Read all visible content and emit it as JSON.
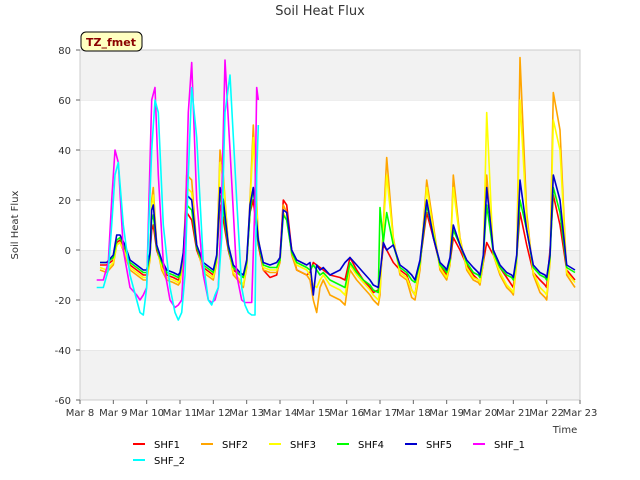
{
  "chart_data": {
    "type": "line",
    "title": "Soil Heat Flux",
    "xlabel": "Time",
    "ylabel": "Soil Heat Flux",
    "badge": "TZ_fmet",
    "ylim": [
      -60,
      80
    ],
    "yticks": [
      -60,
      -40,
      -20,
      0,
      20,
      40,
      60,
      80
    ],
    "xlim": [
      0,
      15
    ],
    "xticks": [
      0,
      1,
      2,
      3,
      4,
      5,
      6,
      7,
      8,
      9,
      10,
      11,
      12,
      13,
      14,
      15
    ],
    "xtick_labels": [
      "Mar 8",
      "Mar 9",
      "Mar 10",
      "Mar 11",
      "Mar 12",
      "Mar 13",
      "Mar 14",
      "Mar 15",
      "Mar 16",
      "Mar 17",
      "Mar 18",
      "Mar 19",
      "Mar 20",
      "Mar 21",
      "Mar 22",
      "Mar 23"
    ],
    "x_unit": "days since Mar 8",
    "grid": "horizontal bands",
    "legend_position": "bottom",
    "series": [
      {
        "name": "SHF1",
        "color": "#ff0000",
        "x": [
          0.6,
          0.8,
          1.0,
          1.1,
          1.2,
          1.35,
          1.5,
          1.7,
          1.9,
          2.0,
          2.1,
          2.15,
          2.2,
          2.3,
          2.45,
          2.6,
          2.8,
          2.95,
          3.0,
          3.1,
          3.2,
          3.35,
          3.5,
          3.7,
          3.9,
          4.0,
          4.1,
          4.2,
          4.3,
          4.45,
          4.6,
          4.8,
          4.9,
          5.0,
          5.1,
          5.2,
          5.35,
          5.5,
          5.7,
          5.9,
          6.0,
          6.1,
          6.2,
          6.35,
          6.5,
          6.8,
          6.9,
          7.0,
          7.1,
          7.2,
          7.3,
          7.5,
          7.8,
          7.95,
          8.1,
          8.3,
          8.5,
          8.7,
          8.8,
          8.95,
          9.0,
          9.1,
          9.2,
          9.4,
          9.6,
          9.8,
          9.95,
          10.05,
          10.2,
          10.4,
          10.6,
          10.8,
          10.95,
          11.0,
          11.1,
          11.2,
          11.4,
          11.6,
          11.8,
          11.95,
          12.0,
          12.1,
          12.2,
          12.4,
          12.6,
          12.8,
          12.95,
          13.0,
          13.1,
          13.2,
          13.4,
          13.6,
          13.8,
          13.95,
          14.0,
          14.1,
          14.2,
          14.4,
          14.6,
          14.85
        ],
        "y": [
          -6,
          -6,
          -4,
          3,
          4,
          0,
          -6,
          -8,
          -10,
          -10,
          -2,
          8,
          10,
          0,
          -6,
          -10,
          -11,
          -12,
          -11,
          -2,
          15,
          12,
          0,
          -7,
          -9,
          -10,
          -3,
          18,
          12,
          0,
          -8,
          -10,
          -11,
          -5,
          15,
          20,
          2,
          -8,
          -11,
          -10,
          -3,
          20,
          18,
          0,
          -8,
          -10,
          -9,
          -5,
          -6,
          -7,
          -8,
          -10,
          -11,
          -12,
          -3,
          -8,
          -12,
          -15,
          -17,
          -16,
          -12,
          2,
          0,
          -5,
          -8,
          -10,
          -16,
          -18,
          -5,
          15,
          5,
          -6,
          -9,
          -10,
          -5,
          5,
          0,
          -6,
          -10,
          -12,
          -13,
          -5,
          3,
          -2,
          -7,
          -11,
          -14,
          -15,
          -3,
          15,
          2,
          -9,
          -12,
          -14,
          -15,
          0,
          22,
          10,
          -8,
          -12
        ]
      },
      {
        "name": "SHF2",
        "color": "#ffa500",
        "x": [
          0.6,
          0.8,
          1.0,
          1.1,
          1.2,
          1.35,
          1.5,
          1.7,
          1.9,
          2.0,
          2.1,
          2.15,
          2.2,
          2.3,
          2.45,
          2.6,
          2.8,
          2.95,
          3.0,
          3.1,
          3.2,
          3.35,
          3.5,
          3.7,
          3.9,
          4.0,
          4.1,
          4.2,
          4.3,
          4.45,
          4.6,
          4.8,
          4.9,
          5.0,
          5.1,
          5.2,
          5.35,
          5.5,
          5.7,
          5.9,
          6.0,
          6.1,
          6.2,
          6.35,
          6.5,
          6.8,
          6.9,
          7.0,
          7.1,
          7.2,
          7.3,
          7.5,
          7.8,
          7.95,
          8.1,
          8.3,
          8.5,
          8.7,
          8.8,
          8.95,
          9.0,
          9.1,
          9.2,
          9.4,
          9.6,
          9.8,
          9.95,
          10.05,
          10.2,
          10.4,
          10.6,
          10.8,
          10.95,
          11.0,
          11.1,
          11.2,
          11.4,
          11.6,
          11.8,
          11.95,
          12.0,
          12.1,
          12.2,
          12.4,
          12.6,
          12.8,
          12.95,
          13.0,
          13.1,
          13.2,
          13.4,
          13.6,
          13.8,
          13.95,
          14.0,
          14.1,
          14.2,
          14.4,
          14.6,
          14.85
        ],
        "y": [
          -8,
          -9,
          -6,
          2,
          3,
          -2,
          -8,
          -10,
          -12,
          -12,
          -4,
          20,
          25,
          2,
          -8,
          -12,
          -13,
          -14,
          -13,
          -4,
          30,
          28,
          2,
          -9,
          -11,
          -12,
          -5,
          40,
          30,
          2,
          -10,
          -13,
          -15,
          -7,
          20,
          50,
          5,
          -8,
          -9,
          -9,
          -5,
          18,
          15,
          -2,
          -8,
          -10,
          -12,
          -20,
          -25,
          -15,
          -12,
          -18,
          -20,
          -22,
          -8,
          -12,
          -15,
          -18,
          -20,
          -22,
          -18,
          10,
          37,
          5,
          -10,
          -12,
          -19,
          -20,
          -8,
          28,
          10,
          -8,
          -11,
          -12,
          -6,
          30,
          5,
          -8,
          -12,
          -13,
          -14,
          -5,
          30,
          -2,
          -10,
          -15,
          -17,
          -18,
          -5,
          77,
          15,
          -10,
          -17,
          -19,
          -20,
          -5,
          63,
          48,
          -10,
          -15
        ]
      },
      {
        "name": "SHF3",
        "color": "#ffff00",
        "x": [
          0.6,
          0.8,
          1.0,
          1.1,
          1.2,
          1.35,
          1.5,
          1.7,
          1.9,
          2.0,
          2.1,
          2.15,
          2.2,
          2.3,
          2.45,
          2.6,
          2.8,
          2.95,
          3.0,
          3.1,
          3.2,
          3.35,
          3.5,
          3.7,
          3.9,
          4.0,
          4.1,
          4.2,
          4.3,
          4.45,
          4.6,
          4.8,
          4.9,
          5.0,
          5.1,
          5.2,
          5.35,
          5.5,
          5.7,
          5.9,
          6.0,
          6.1,
          6.2,
          6.35,
          6.5,
          6.8,
          6.9,
          7.0,
          7.1,
          7.2,
          7.3,
          7.5,
          7.8,
          7.95,
          8.1,
          8.3,
          8.5,
          8.7,
          8.8,
          8.95,
          9.0,
          9.1,
          9.2,
          9.4,
          9.6,
          9.8,
          9.95,
          10.05,
          10.2,
          10.4,
          10.6,
          10.8,
          10.95,
          11.0,
          11.1,
          11.2,
          11.4,
          11.6,
          11.8,
          11.95,
          12.0,
          12.1,
          12.2,
          12.4,
          12.6,
          12.8,
          12.95,
          13.0,
          13.1,
          13.2,
          13.4,
          13.6,
          13.8,
          13.95,
          14.0,
          14.1,
          14.2,
          14.4,
          14.6,
          14.85
        ],
        "y": [
          -7,
          -8,
          -5,
          2,
          3,
          -1,
          -7,
          -9,
          -11,
          -11,
          -3,
          18,
          22,
          2,
          -7,
          -11,
          -12,
          -13,
          -12,
          -3,
          25,
          23,
          2,
          -8,
          -10,
          -11,
          -4,
          35,
          28,
          2,
          -9,
          -12,
          -14,
          -6,
          18,
          45,
          4,
          -7,
          -8,
          -8,
          -4,
          15,
          12,
          -1,
          -6,
          -8,
          -10,
          -14,
          -15,
          -12,
          -10,
          -14,
          -16,
          -18,
          -6,
          -10,
          -13,
          -16,
          -18,
          -20,
          -16,
          8,
          30,
          4,
          -9,
          -11,
          -16,
          -18,
          -6,
          25,
          8,
          -7,
          -10,
          -11,
          -5,
          25,
          4,
          -7,
          -11,
          -12,
          -13,
          -4,
          55,
          -2,
          -9,
          -14,
          -16,
          -17,
          -4,
          60,
          12,
          -9,
          -15,
          -17,
          -18,
          -4,
          52,
          40,
          -9,
          -13
        ]
      },
      {
        "name": "SHF4",
        "color": "#00ff00",
        "x": [
          0.6,
          0.8,
          1.0,
          1.1,
          1.2,
          1.35,
          1.5,
          1.7,
          1.9,
          2.0,
          2.1,
          2.15,
          2.2,
          2.3,
          2.45,
          2.6,
          2.8,
          2.95,
          3.0,
          3.1,
          3.2,
          3.35,
          3.5,
          3.7,
          3.9,
          4.0,
          4.1,
          4.2,
          4.3,
          4.45,
          4.6,
          4.8,
          4.9,
          5.0,
          5.1,
          5.2,
          5.35,
          5.5,
          5.7,
          5.9,
          6.0,
          6.1,
          6.2,
          6.35,
          6.5,
          6.8,
          6.9,
          7.0,
          7.1,
          7.2,
          7.3,
          7.5,
          7.8,
          7.95,
          8.1,
          8.3,
          8.5,
          8.7,
          8.8,
          8.95,
          9.0,
          9.1,
          9.2,
          9.4,
          9.6,
          9.8,
          9.95,
          10.05,
          10.2,
          10.4,
          10.6,
          10.8,
          10.95,
          11.0,
          11.1,
          11.2,
          11.4,
          11.6,
          11.8,
          11.95,
          12.0,
          12.1,
          12.2,
          12.4,
          12.6,
          12.8,
          12.95,
          13.0,
          13.1,
          13.2,
          13.4,
          13.6,
          13.8,
          13.95,
          14.0,
          14.1,
          14.2,
          14.4,
          14.6,
          14.85
        ],
        "y": [
          -5,
          -5,
          -3,
          4,
          5,
          1,
          -5,
          -7,
          -9,
          -9,
          -2,
          12,
          14,
          1,
          -5,
          -9,
          -10,
          -11,
          -10,
          -2,
          18,
          16,
          1,
          -6,
          -8,
          -9,
          -3,
          22,
          16,
          1,
          -7,
          -10,
          -11,
          -5,
          15,
          25,
          3,
          -6,
          -7,
          -7,
          -4,
          14,
          12,
          -1,
          -5,
          -7,
          -8,
          -6,
          -8,
          -10,
          -9,
          -12,
          -14,
          -15,
          -5,
          -9,
          -12,
          -14,
          -16,
          -17,
          17,
          3,
          15,
          2,
          -7,
          -9,
          -12,
          -13,
          -5,
          18,
          6,
          -6,
          -8,
          -9,
          -4,
          8,
          2,
          -5,
          -9,
          -10,
          -11,
          -3,
          18,
          -1,
          -7,
          -10,
          -11,
          -12,
          -3,
          20,
          8,
          -7,
          -10,
          -11,
          -12,
          -3,
          25,
          15,
          -7,
          -9
        ]
      },
      {
        "name": "SHF5",
        "color": "#0000cd",
        "x": [
          0.6,
          0.8,
          1.0,
          1.1,
          1.2,
          1.35,
          1.5,
          1.7,
          1.9,
          2.0,
          2.1,
          2.15,
          2.2,
          2.3,
          2.45,
          2.6,
          2.8,
          2.95,
          3.0,
          3.1,
          3.2,
          3.35,
          3.5,
          3.7,
          3.9,
          4.0,
          4.1,
          4.2,
          4.3,
          4.45,
          4.6,
          4.8,
          4.9,
          5.0,
          5.1,
          5.2,
          5.35,
          5.5,
          5.7,
          5.9,
          6.0,
          6.1,
          6.2,
          6.35,
          6.5,
          6.8,
          6.9,
          7.0,
          7.1,
          7.2,
          7.3,
          7.5,
          7.8,
          7.95,
          8.1,
          8.3,
          8.5,
          8.7,
          8.8,
          8.95,
          9.0,
          9.1,
          9.2,
          9.4,
          9.6,
          9.8,
          9.95,
          10.05,
          10.2,
          10.4,
          10.6,
          10.8,
          10.95,
          11.0,
          11.1,
          11.2,
          11.4,
          11.6,
          11.8,
          11.95,
          12.0,
          12.1,
          12.2,
          12.4,
          12.6,
          12.8,
          12.95,
          13.0,
          13.1,
          13.2,
          13.4,
          13.6,
          13.8,
          13.95,
          14.0,
          14.1,
          14.2,
          14.4,
          14.6,
          14.85
        ],
        "y": [
          -5,
          -5,
          -2,
          6,
          6,
          2,
          -4,
          -6,
          -8,
          -8,
          -1,
          16,
          18,
          2,
          -4,
          -8,
          -9,
          -10,
          -9,
          -1,
          22,
          20,
          2,
          -5,
          -7,
          -8,
          -2,
          25,
          20,
          2,
          -6,
          -9,
          -10,
          -4,
          18,
          25,
          4,
          -5,
          -6,
          -5,
          -3,
          16,
          15,
          0,
          -4,
          -6,
          -5,
          -18,
          -6,
          -8,
          -7,
          -10,
          -8,
          -5,
          -3,
          -6,
          -9,
          -12,
          -14,
          -15,
          -10,
          3,
          0,
          2,
          -6,
          -8,
          -10,
          -12,
          -4,
          20,
          5,
          -5,
          -7,
          -8,
          -3,
          10,
          2,
          -4,
          -7,
          -9,
          -10,
          -2,
          25,
          0,
          -6,
          -9,
          -10,
          -11,
          -2,
          28,
          8,
          -6,
          -9,
          -10,
          -11,
          -2,
          30,
          20,
          -6,
          -8
        ]
      },
      {
        "name": "SHF_1",
        "color": "#ff00ff",
        "x": [
          0.5,
          0.7,
          0.85,
          0.95,
          1.05,
          1.15,
          1.3,
          1.5,
          1.7,
          1.8,
          1.9,
          2.0,
          2.05,
          2.15,
          2.25,
          2.35,
          2.5,
          2.7,
          2.85,
          2.95,
          3.05,
          3.15,
          3.25,
          3.35,
          3.5,
          3.7,
          3.85,
          3.95,
          4.05,
          4.15,
          4.25,
          4.35,
          4.5,
          4.7,
          4.85,
          4.95,
          5.05,
          5.15,
          5.25,
          5.3,
          5.35
        ],
        "y": [
          -12,
          -12,
          -5,
          20,
          40,
          35,
          0,
          -15,
          -18,
          -20,
          -18,
          -15,
          10,
          60,
          65,
          30,
          -5,
          -20,
          -23,
          -22,
          -20,
          5,
          55,
          75,
          20,
          -10,
          -20,
          -21,
          -20,
          -15,
          20,
          76,
          40,
          -10,
          -20,
          -21,
          -21,
          -21,
          20,
          65,
          60
        ]
      },
      {
        "name": "SHF_2",
        "color": "#00ffff",
        "x": [
          0.5,
          0.7,
          0.85,
          0.95,
          1.05,
          1.15,
          1.3,
          1.5,
          1.7,
          1.8,
          1.9,
          2.0,
          2.05,
          2.15,
          2.25,
          2.35,
          2.5,
          2.7,
          2.85,
          2.95,
          3.05,
          3.15,
          3.25,
          3.35,
          3.5,
          3.7,
          3.85,
          3.95,
          4.05,
          4.15,
          4.25,
          4.35,
          4.5,
          4.7,
          4.85,
          4.95,
          5.05,
          5.15,
          5.25,
          5.3,
          5.35
        ],
        "y": [
          -15,
          -15,
          -8,
          10,
          30,
          35,
          10,
          -10,
          -20,
          -25,
          -26,
          -15,
          5,
          40,
          60,
          55,
          10,
          -15,
          -25,
          -28,
          -25,
          -10,
          30,
          65,
          45,
          -5,
          -20,
          -22,
          -18,
          -15,
          5,
          55,
          70,
          20,
          -15,
          -22,
          -25,
          -26,
          -26,
          30,
          50
        ]
      }
    ]
  }
}
